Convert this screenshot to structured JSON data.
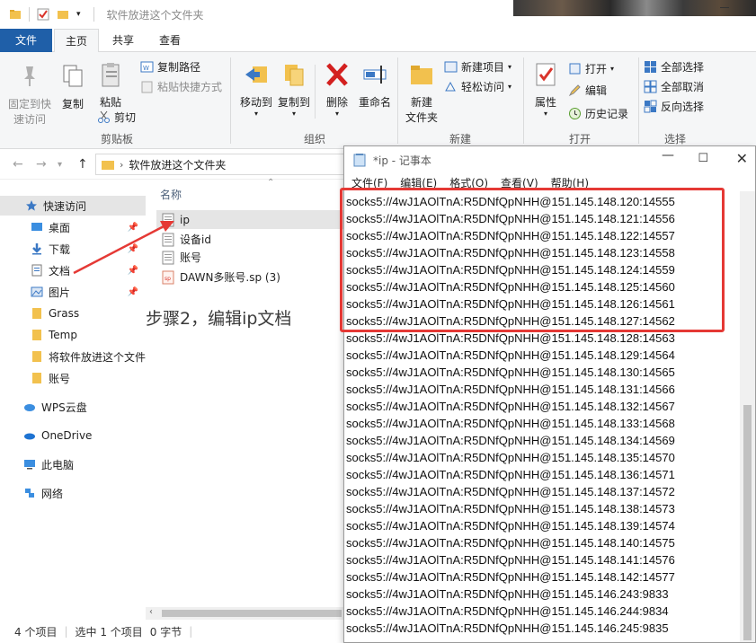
{
  "explorer": {
    "title": "软件放进这个文件夹",
    "tabs": {
      "file": "文件",
      "home": "主页",
      "share": "共享",
      "view": "查看"
    },
    "ribbon": {
      "pin_quick_access": [
        "固定到快",
        "速访问"
      ],
      "copy": "复制",
      "paste": "粘贴",
      "copy_path": "复制路径",
      "paste_shortcut": "粘贴快捷方式",
      "cut": "剪切",
      "group_clipboard": "剪贴板",
      "move_to": "移动到",
      "copy_to": "复制到",
      "delete": "删除",
      "rename": "重命名",
      "group_organize": "组织",
      "new_folder": [
        "新建",
        "文件夹"
      ],
      "new_item": "新建项目",
      "easy_access": "轻松访问",
      "group_new": "新建",
      "properties": "属性",
      "open": "打开",
      "edit": "编辑",
      "history": "历史记录",
      "group_open": "打开",
      "select_all": "全部选择",
      "select_none": "全部取消",
      "invert_selection": "反向选择",
      "group_select": "选择"
    },
    "address": {
      "path": "软件放进这个文件夹"
    },
    "nav": [
      {
        "label": "快速访问",
        "icon": "star-icon"
      },
      {
        "label": "桌面",
        "icon": "desktop-icon"
      },
      {
        "label": "下载",
        "icon": "download-icon"
      },
      {
        "label": "文档",
        "icon": "document-icon"
      },
      {
        "label": "图片",
        "icon": "picture-icon"
      },
      {
        "label": "Grass",
        "icon": "folder-icon"
      },
      {
        "label": "Temp",
        "icon": "folder-icon"
      },
      {
        "label": "将软件放进这个文件",
        "icon": "folder-icon"
      },
      {
        "label": "账号",
        "icon": "folder-icon"
      },
      {
        "label": "WPS云盘",
        "icon": "cloud-icon"
      },
      {
        "label": "OneDrive",
        "icon": "onedrive-icon"
      },
      {
        "label": "此电脑",
        "icon": "computer-icon"
      },
      {
        "label": "网络",
        "icon": "network-icon"
      }
    ],
    "column_name": "名称",
    "files": [
      {
        "name": "ip",
        "icon": "text-file-icon"
      },
      {
        "name": "设备id",
        "icon": "text-file-icon"
      },
      {
        "name": "账号",
        "icon": "text-file-icon"
      },
      {
        "name": "DAWN多账号.sp (3)",
        "icon": "sp-file-icon"
      }
    ],
    "annotation": "步骤2，编辑ip文档",
    "status": {
      "items": "4 个项目",
      "selected": "选中 1 个项目",
      "size": "0 字节"
    }
  },
  "notepad": {
    "title": "*ip - 记事本",
    "menu": [
      "文件(F)",
      "编辑(E)",
      "格式(O)",
      "查看(V)",
      "帮助(H)"
    ],
    "lines": [
      "socks5://4wJ1AOlTnA:R5DNfQpNHH@151.145.148.120:14555",
      "socks5://4wJ1AOlTnA:R5DNfQpNHH@151.145.148.121:14556",
      "socks5://4wJ1AOlTnA:R5DNfQpNHH@151.145.148.122:14557",
      "socks5://4wJ1AOlTnA:R5DNfQpNHH@151.145.148.123:14558",
      "socks5://4wJ1AOlTnA:R5DNfQpNHH@151.145.148.124:14559",
      "socks5://4wJ1AOlTnA:R5DNfQpNHH@151.145.148.125:14560",
      "socks5://4wJ1AOlTnA:R5DNfQpNHH@151.145.148.126:14561",
      "socks5://4wJ1AOlTnA:R5DNfQpNHH@151.145.148.127:14562",
      "socks5://4wJ1AOlTnA:R5DNfQpNHH@151.145.148.128:14563",
      "socks5://4wJ1AOlTnA:R5DNfQpNHH@151.145.148.129:14564",
      "socks5://4wJ1AOlTnA:R5DNfQpNHH@151.145.148.130:14565",
      "socks5://4wJ1AOlTnA:R5DNfQpNHH@151.145.148.131:14566",
      "socks5://4wJ1AOlTnA:R5DNfQpNHH@151.145.148.132:14567",
      "socks5://4wJ1AOlTnA:R5DNfQpNHH@151.145.148.133:14568",
      "socks5://4wJ1AOlTnA:R5DNfQpNHH@151.145.148.134:14569",
      "socks5://4wJ1AOlTnA:R5DNfQpNHH@151.145.148.135:14570",
      "socks5://4wJ1AOlTnA:R5DNfQpNHH@151.145.148.136:14571",
      "socks5://4wJ1AOlTnA:R5DNfQpNHH@151.145.148.137:14572",
      "socks5://4wJ1AOlTnA:R5DNfQpNHH@151.145.148.138:14573",
      "socks5://4wJ1AOlTnA:R5DNfQpNHH@151.145.148.139:14574",
      "socks5://4wJ1AOlTnA:R5DNfQpNHH@151.145.148.140:14575",
      "socks5://4wJ1AOlTnA:R5DNfQpNHH@151.145.148.141:14576",
      "socks5://4wJ1AOlTnA:R5DNfQpNHH@151.145.148.142:14577",
      "socks5://4wJ1AOlTnA:R5DNfQpNHH@151.145.146.243:9833",
      "socks5://4wJ1AOlTnA:R5DNfQpNHH@151.145.146.244:9834",
      "socks5://4wJ1AOlTnA:R5DNfQpNHH@151.145.146.245:9835"
    ]
  },
  "colors": {
    "file_tab": "#1f5fa8",
    "highlight": "#e53935",
    "folder": "#f2c14e",
    "selection": "#e5e5e5"
  }
}
